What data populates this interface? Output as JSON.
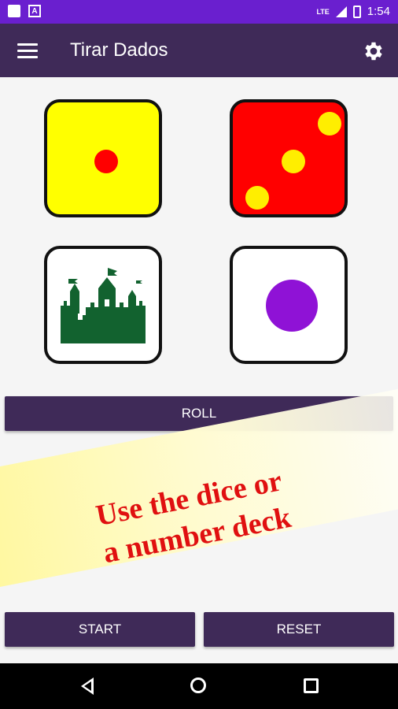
{
  "status": {
    "time": "1:54",
    "network": "LTE"
  },
  "app_bar": {
    "title": "Tirar Dados"
  },
  "buttons": {
    "roll": "ROLL",
    "start": "START",
    "reset": "RESET"
  },
  "promo": {
    "line1": "Use the dice or",
    "line2": "a number deck"
  },
  "colors": {
    "status_bar": "#6a1fcf",
    "app_bar": "#3f2a58",
    "yellow_die": "#ffff00",
    "red_die": "#ff0000",
    "red_pip": "#ff0000",
    "yellow_pip": "#ffee00",
    "castle": "#12622f",
    "purple_pip": "#8f12d6"
  },
  "dice": [
    {
      "face": "1 red pip",
      "background": "yellow"
    },
    {
      "face": "3 yellow pips",
      "background": "red"
    },
    {
      "face": "castle-icon",
      "background": "white"
    },
    {
      "face": "1 purple pip",
      "background": "white"
    }
  ]
}
